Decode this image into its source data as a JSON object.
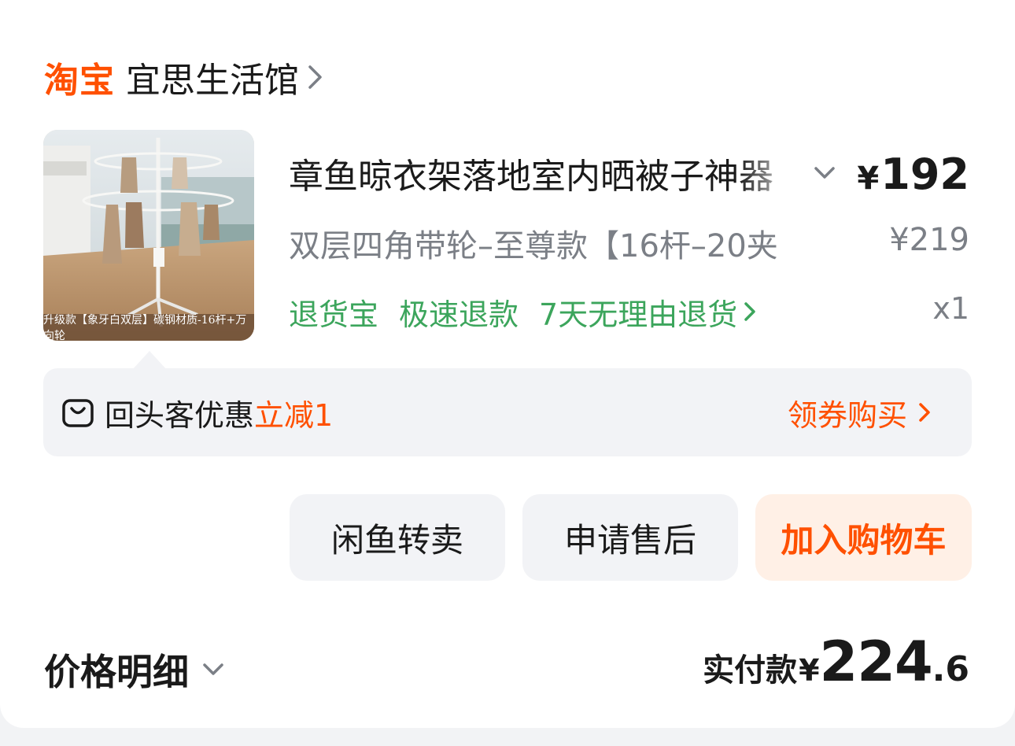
{
  "shop": {
    "platform": "淘宝",
    "name": "宜思生活馆"
  },
  "product": {
    "title": "章鱼晾衣架落地室内晒被子神器",
    "sku": "双层四角带轮–至尊款【16杆–20夹",
    "price_symbol": "¥",
    "price": "192",
    "original_price": "¥219",
    "quantity": "x1",
    "image_caption": "升级款【象牙白双层】碳钢材质-16杆+万向轮",
    "image_icon": "clothes-drying-rack-photo",
    "services": [
      "退货宝",
      "极速退款",
      "7天无理由退货"
    ]
  },
  "promo": {
    "label": "回头客优惠",
    "discount": "立减1",
    "action": "领券购买",
    "icon": "shopping-bag-icon"
  },
  "actions": {
    "xianyu": "闲鱼转卖",
    "aftersale": "申请售后",
    "add_to_cart": "加入购物车"
  },
  "footer": {
    "detail_label": "价格明细",
    "paid_label": "实付款",
    "paid_symbol": "¥",
    "paid_integer": "224",
    "paid_decimal": ".6"
  },
  "colors": {
    "brand_orange": "#ff5000",
    "service_green": "#3ca55c",
    "muted_text": "#7b7f86",
    "panel_gray": "#f2f3f6"
  }
}
